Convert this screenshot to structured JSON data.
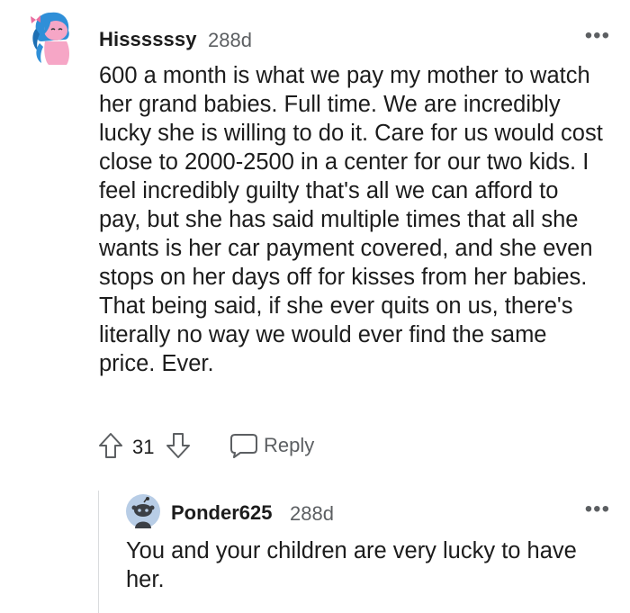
{
  "comment": {
    "username": "Hissssssy",
    "age": "288d",
    "more_label": "•••",
    "body": "600 a month is what we pay my mother to watch her grand babies. Full time. We are incredibly lucky she is willing to do it. Care for us would cost close to 2000-2500 in a center for our two kids. I feel incredibly guilty that's all we can afford to pay, but she has said multiple times that all she wants is her car payment covered, and she even stops on her days off for kisses from her babies. That being said, if she ever quits on us, there's literally no way we would ever find the same price. Ever.",
    "vote_count": "31",
    "reply_label": "Reply",
    "icons": {
      "avatar": "avatar-snoo-blue-hair-icon",
      "upvote": "upvote-arrow-icon",
      "downvote": "downvote-arrow-icon",
      "reply": "speech-bubble-icon"
    }
  },
  "reply": {
    "username": "Ponder625",
    "age": "288d",
    "more_label": "•••",
    "body": "You and your children are very lucky to have her.",
    "icons": {
      "avatar": "avatar-default-snoo-icon"
    }
  },
  "colors": {
    "text": "#1c1c1c",
    "meta": "#5c5f62",
    "thread_line": "#dadcde",
    "avatar_hair": "#2f8fd8",
    "avatar_skin": "#f6a6c6",
    "reply_avatar_bg": "#b8cde6"
  }
}
